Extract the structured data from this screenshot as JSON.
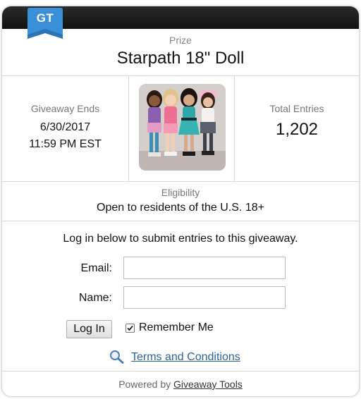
{
  "badge": {
    "text": "GT"
  },
  "prize": {
    "label": "Prize",
    "name": "Starpath 18\" Doll"
  },
  "stats": {
    "ends_label": "Giveaway Ends",
    "ends_date": "6/30/2017",
    "ends_time": "11:59 PM EST",
    "entries_label": "Total Entries",
    "entries_count": "1,202"
  },
  "eligibility": {
    "label": "Eligibility",
    "text": "Open to residents of the U.S. 18+"
  },
  "login": {
    "intro": "Log in below to submit entries to this giveaway.",
    "email_label": "Email:",
    "email_value": "",
    "name_label": "Name:",
    "name_value": "",
    "button_label": "Log In",
    "remember_label": "Remember Me",
    "remember_checked": true,
    "terms_label": "Terms and Conditions"
  },
  "footer": {
    "powered_prefix": "Powered by",
    "powered_link": "Giveaway Tools"
  },
  "colors": {
    "badge_blue": "#3a8fd9",
    "top_bar": "#161616",
    "link": "#2a6496"
  },
  "icons": {
    "search": "magnifier-icon",
    "checkbox": "checkmark-icon"
  }
}
